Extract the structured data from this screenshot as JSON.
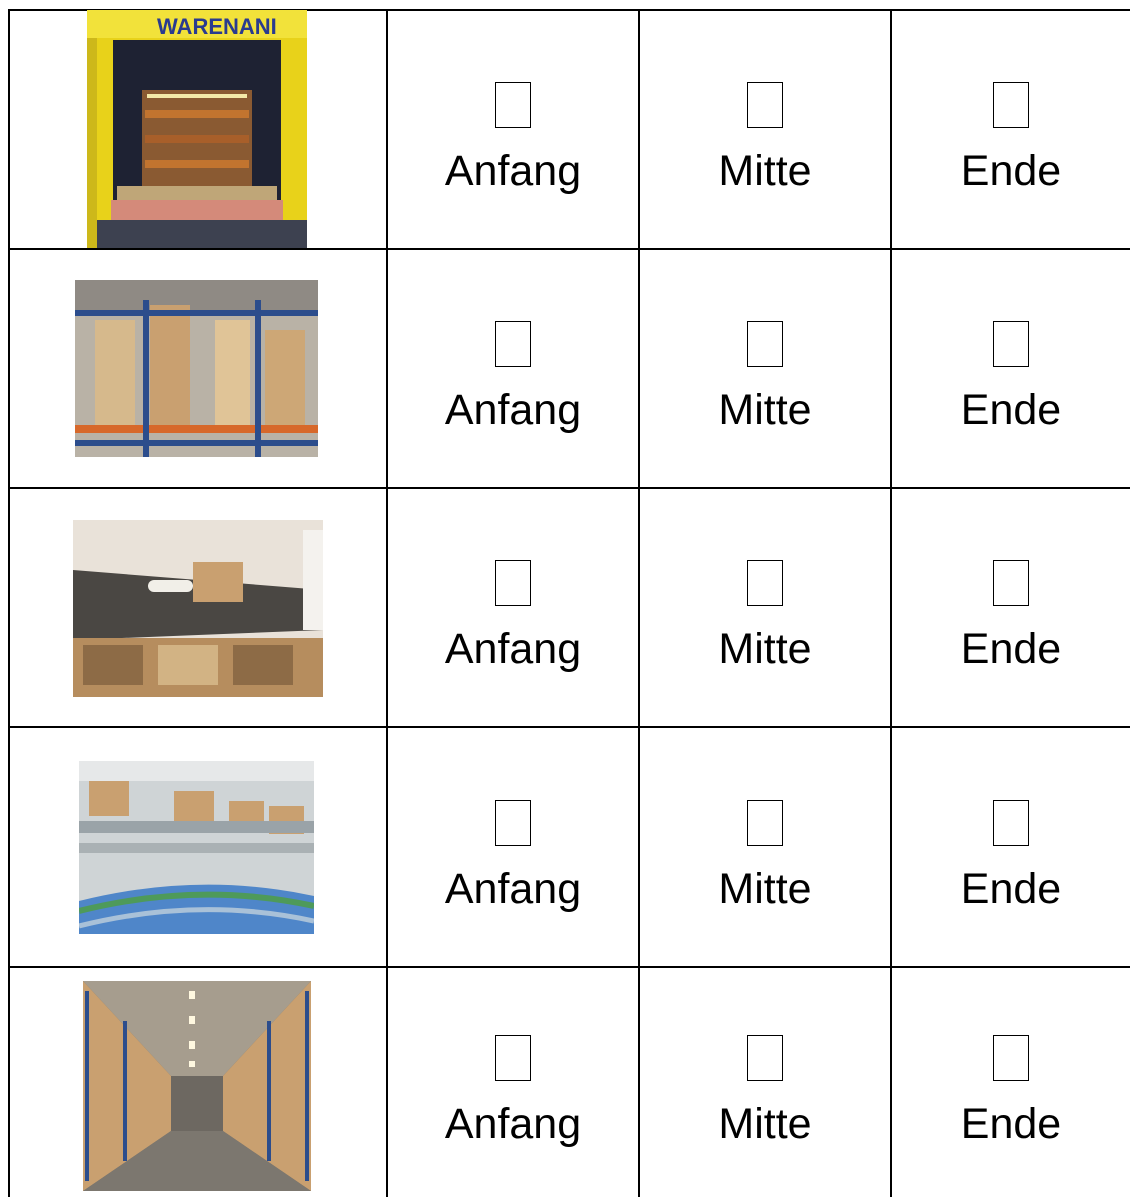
{
  "rows": [
    {
      "photo_name": "loading-dock-photo",
      "photo_sign": "WARENANI",
      "options": [
        "Anfang",
        "Mitte",
        "Ende"
      ]
    },
    {
      "photo_name": "storage-rack-photo",
      "options": [
        "Anfang",
        "Mitte",
        "Ende"
      ]
    },
    {
      "photo_name": "packing-table-photo",
      "options": [
        "Anfang",
        "Mitte",
        "Ende"
      ]
    },
    {
      "photo_name": "conveyor-belt-photo",
      "options": [
        "Anfang",
        "Mitte",
        "Ende"
      ]
    },
    {
      "photo_name": "warehouse-aisle-photo",
      "options": [
        "Anfang",
        "Mitte",
        "Ende"
      ]
    }
  ],
  "colors": {
    "border": "#000000",
    "dock_wall": "#e8d21a",
    "cardboard": "#c9a070",
    "rack_blue": "#2c4d8c",
    "rack_orange": "#d7682a"
  }
}
